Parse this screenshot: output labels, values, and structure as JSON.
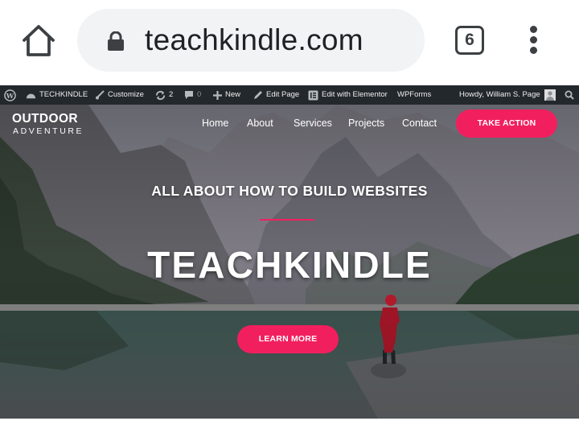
{
  "browser": {
    "url": "teachkindle.com",
    "tab_count": "6"
  },
  "admin_bar": {
    "site_name": "TECHKINDLE",
    "customize": "Customize",
    "updates_count": "2",
    "comments_count": "0",
    "new": "New",
    "edit_page": "Edit Page",
    "edit_elementor": "Edit with Elementor",
    "wpforms": "WPForms",
    "howdy": "Howdy, William S. Page"
  },
  "site": {
    "logo_line1": "OUTDOOR",
    "logo_line2": "ADVENTURE",
    "nav": [
      "Home",
      "About",
      "Services",
      "Projects",
      "Contact"
    ],
    "cta": "TAKE ACTION"
  },
  "hero": {
    "kicker": "ALL ABOUT HOW TO BUILD WEBSITES",
    "headline": "TEACHKINDLE",
    "button": "LEARN MORE"
  },
  "colors": {
    "accent": "#f21f5f",
    "admin_bar": "#23282d",
    "url_pill": "#f1f3f4"
  }
}
